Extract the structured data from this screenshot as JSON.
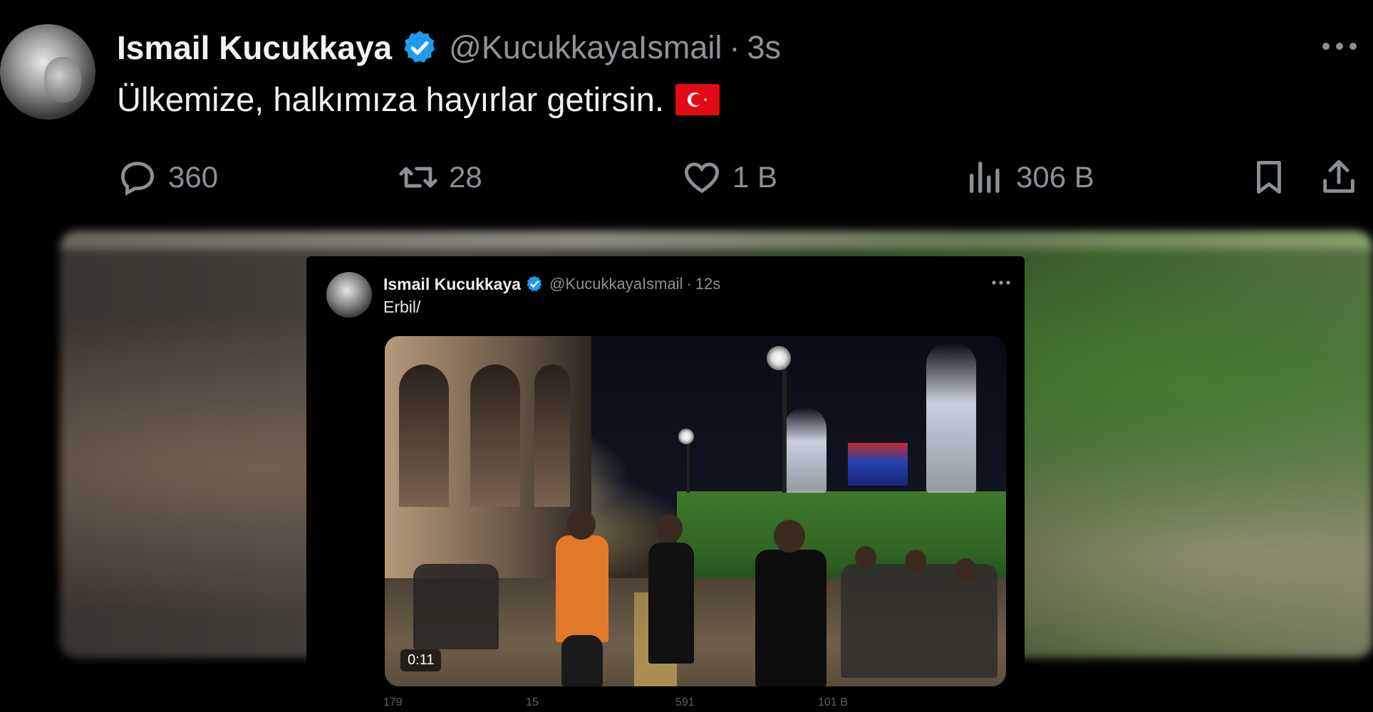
{
  "tweet": {
    "author_name": "Ismail Kucukkaya",
    "handle": "@KucukkayaIsmail",
    "separator": "·",
    "time": "3s",
    "text": "Ülkemize, halkımıza hayırlar getirsin.",
    "flag": "turkey-flag",
    "actions": {
      "replies": "360",
      "retweets": "28",
      "likes": "1 B",
      "views": "306 B"
    },
    "icons": [
      "reply-icon",
      "retweet-icon",
      "like-icon",
      "views-icon",
      "bookmark-icon",
      "share-icon",
      "more-icon",
      "verified-icon"
    ]
  },
  "quoted": {
    "author_name": "Ismail Kucukkaya",
    "handle": "@KucukkayaIsmail",
    "separator": "·",
    "time": "12s",
    "text": "Erbil/",
    "video_duration": "0:11",
    "actions": {
      "replies": "179",
      "retweets": "15",
      "likes": "591",
      "views": "101 B"
    }
  },
  "colors": {
    "background": "#000000",
    "verified": "#1d9bf0",
    "muted_text": "#8b9096",
    "flag_red": "#e30a17"
  }
}
